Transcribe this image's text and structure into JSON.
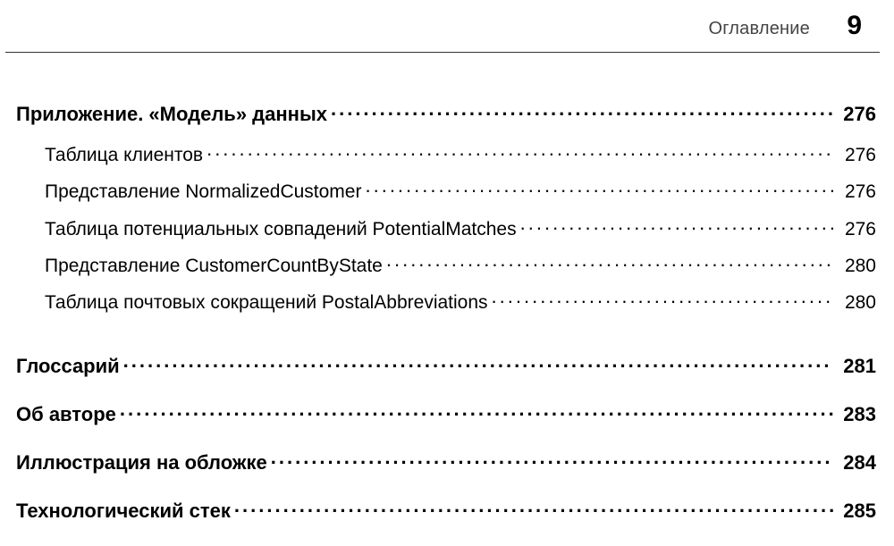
{
  "header": {
    "label": "Оглавление",
    "page_number": "9"
  },
  "toc": {
    "sections": [
      {
        "title": "Приложение. «Модель» данных",
        "page": "276",
        "items": [
          {
            "title": "Таблица клиентов",
            "page": "276"
          },
          {
            "title": "Представление NormalizedCustomer ",
            "page": "276"
          },
          {
            "title": "Таблица потенциальных совпадений PotentialMatches",
            "page": "276"
          },
          {
            "title": "Представление CustomerCountByState ",
            "page": "280"
          },
          {
            "title": "Таблица почтовых сокращений PostalAbbreviations",
            "page": "280"
          }
        ]
      },
      {
        "title": "Глоссарий",
        "page": "281",
        "items": []
      },
      {
        "title": "Об авторе",
        "page": "283",
        "items": []
      },
      {
        "title": "Иллюстрация на обложке",
        "page": "284",
        "items": []
      },
      {
        "title": "Технологический стек",
        "page": "285",
        "items": []
      }
    ]
  }
}
